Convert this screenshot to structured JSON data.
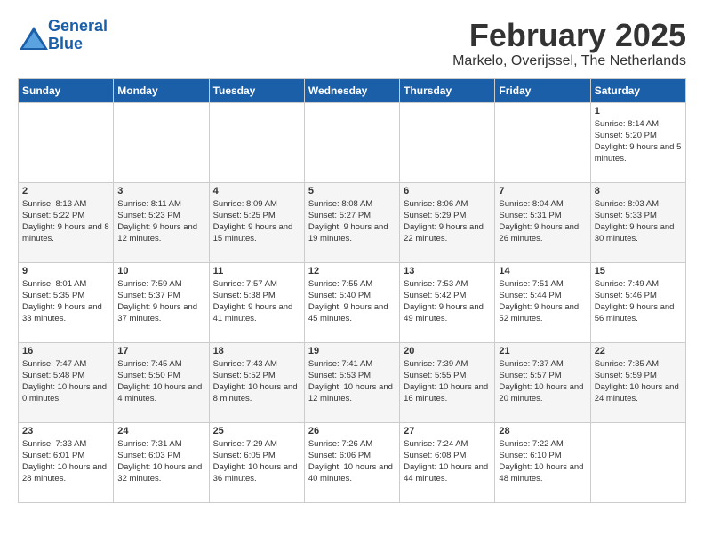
{
  "header": {
    "logo_line1": "General",
    "logo_line2": "Blue",
    "title": "February 2025",
    "subtitle": "Markelo, Overijssel, The Netherlands"
  },
  "days_of_week": [
    "Sunday",
    "Monday",
    "Tuesday",
    "Wednesday",
    "Thursday",
    "Friday",
    "Saturday"
  ],
  "weeks": [
    [
      {
        "day": "",
        "info": ""
      },
      {
        "day": "",
        "info": ""
      },
      {
        "day": "",
        "info": ""
      },
      {
        "day": "",
        "info": ""
      },
      {
        "day": "",
        "info": ""
      },
      {
        "day": "",
        "info": ""
      },
      {
        "day": "1",
        "info": "Sunrise: 8:14 AM\nSunset: 5:20 PM\nDaylight: 9 hours and 5 minutes."
      }
    ],
    [
      {
        "day": "2",
        "info": "Sunrise: 8:13 AM\nSunset: 5:22 PM\nDaylight: 9 hours and 8 minutes."
      },
      {
        "day": "3",
        "info": "Sunrise: 8:11 AM\nSunset: 5:23 PM\nDaylight: 9 hours and 12 minutes."
      },
      {
        "day": "4",
        "info": "Sunrise: 8:09 AM\nSunset: 5:25 PM\nDaylight: 9 hours and 15 minutes."
      },
      {
        "day": "5",
        "info": "Sunrise: 8:08 AM\nSunset: 5:27 PM\nDaylight: 9 hours and 19 minutes."
      },
      {
        "day": "6",
        "info": "Sunrise: 8:06 AM\nSunset: 5:29 PM\nDaylight: 9 hours and 22 minutes."
      },
      {
        "day": "7",
        "info": "Sunrise: 8:04 AM\nSunset: 5:31 PM\nDaylight: 9 hours and 26 minutes."
      },
      {
        "day": "8",
        "info": "Sunrise: 8:03 AM\nSunset: 5:33 PM\nDaylight: 9 hours and 30 minutes."
      }
    ],
    [
      {
        "day": "9",
        "info": "Sunrise: 8:01 AM\nSunset: 5:35 PM\nDaylight: 9 hours and 33 minutes."
      },
      {
        "day": "10",
        "info": "Sunrise: 7:59 AM\nSunset: 5:37 PM\nDaylight: 9 hours and 37 minutes."
      },
      {
        "day": "11",
        "info": "Sunrise: 7:57 AM\nSunset: 5:38 PM\nDaylight: 9 hours and 41 minutes."
      },
      {
        "day": "12",
        "info": "Sunrise: 7:55 AM\nSunset: 5:40 PM\nDaylight: 9 hours and 45 minutes."
      },
      {
        "day": "13",
        "info": "Sunrise: 7:53 AM\nSunset: 5:42 PM\nDaylight: 9 hours and 49 minutes."
      },
      {
        "day": "14",
        "info": "Sunrise: 7:51 AM\nSunset: 5:44 PM\nDaylight: 9 hours and 52 minutes."
      },
      {
        "day": "15",
        "info": "Sunrise: 7:49 AM\nSunset: 5:46 PM\nDaylight: 9 hours and 56 minutes."
      }
    ],
    [
      {
        "day": "16",
        "info": "Sunrise: 7:47 AM\nSunset: 5:48 PM\nDaylight: 10 hours and 0 minutes."
      },
      {
        "day": "17",
        "info": "Sunrise: 7:45 AM\nSunset: 5:50 PM\nDaylight: 10 hours and 4 minutes."
      },
      {
        "day": "18",
        "info": "Sunrise: 7:43 AM\nSunset: 5:52 PM\nDaylight: 10 hours and 8 minutes."
      },
      {
        "day": "19",
        "info": "Sunrise: 7:41 AM\nSunset: 5:53 PM\nDaylight: 10 hours and 12 minutes."
      },
      {
        "day": "20",
        "info": "Sunrise: 7:39 AM\nSunset: 5:55 PM\nDaylight: 10 hours and 16 minutes."
      },
      {
        "day": "21",
        "info": "Sunrise: 7:37 AM\nSunset: 5:57 PM\nDaylight: 10 hours and 20 minutes."
      },
      {
        "day": "22",
        "info": "Sunrise: 7:35 AM\nSunset: 5:59 PM\nDaylight: 10 hours and 24 minutes."
      }
    ],
    [
      {
        "day": "23",
        "info": "Sunrise: 7:33 AM\nSunset: 6:01 PM\nDaylight: 10 hours and 28 minutes."
      },
      {
        "day": "24",
        "info": "Sunrise: 7:31 AM\nSunset: 6:03 PM\nDaylight: 10 hours and 32 minutes."
      },
      {
        "day": "25",
        "info": "Sunrise: 7:29 AM\nSunset: 6:05 PM\nDaylight: 10 hours and 36 minutes."
      },
      {
        "day": "26",
        "info": "Sunrise: 7:26 AM\nSunset: 6:06 PM\nDaylight: 10 hours and 40 minutes."
      },
      {
        "day": "27",
        "info": "Sunrise: 7:24 AM\nSunset: 6:08 PM\nDaylight: 10 hours and 44 minutes."
      },
      {
        "day": "28",
        "info": "Sunrise: 7:22 AM\nSunset: 6:10 PM\nDaylight: 10 hours and 48 minutes."
      },
      {
        "day": "",
        "info": ""
      }
    ]
  ]
}
